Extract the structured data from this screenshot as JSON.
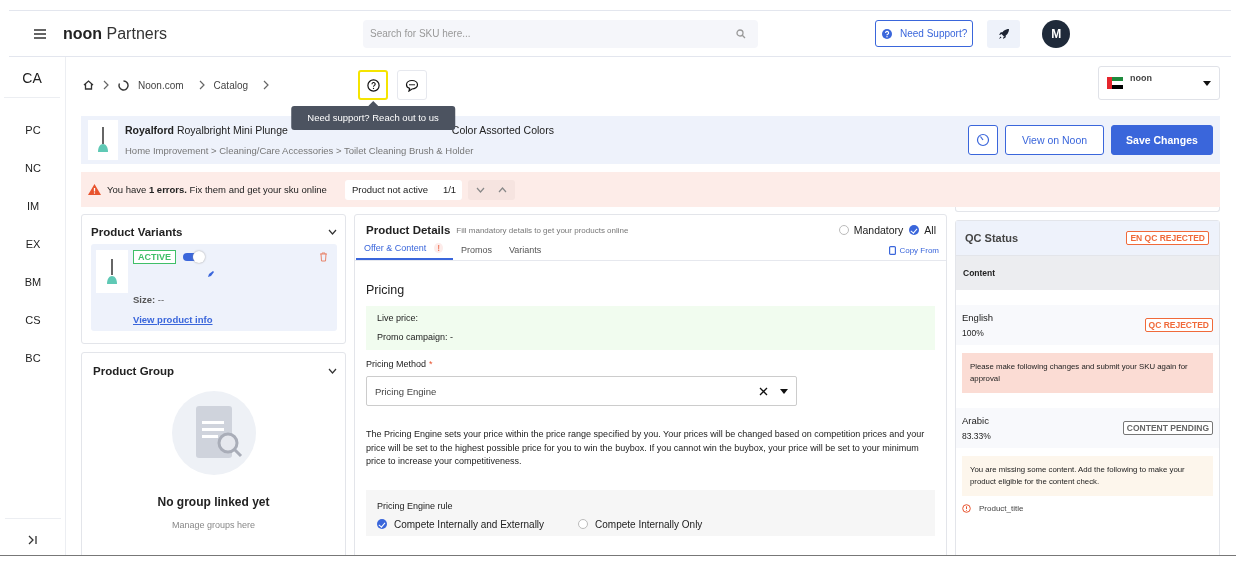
{
  "header": {
    "brand_bold": "noon",
    "brand_rest": "Partners",
    "search": {
      "placeholder": "Search for SKU here..."
    },
    "support_button": "Need Support?",
    "avatar": "M"
  },
  "sidebar": {
    "top": "CA",
    "items": [
      "PC",
      "NC",
      "IM",
      "EX",
      "BM",
      "CS",
      "BC"
    ]
  },
  "breadcrumb": [
    "Noon.com",
    "Catalog"
  ],
  "help_button": {
    "highlighted": true
  },
  "tooltip": "Need support? Reach out to us",
  "store_selector": {
    "name": "noon"
  },
  "product": {
    "brand": "Royalford",
    "title_start": "Royalbright Mini Plunge",
    "title_end": "Color Assorted Colors",
    "category": "Home Improvement > Cleaning/Care Accessories > Toilet Cleaning Brush & Holder"
  },
  "actions": [
    "View on Noon",
    "Save Changes"
  ],
  "error_bar": {
    "message": "You have **1 errors.** Fix them and get your sku online",
    "chip": "Product not active",
    "count": "1/1"
  },
  "variants": {
    "title": "Product Variants",
    "status": "ACTIVE",
    "on": true,
    "size_label": "Size:",
    "size_value": "--",
    "link": "View product info"
  },
  "group": {
    "title": "Product Group",
    "empty_title": "No group linked yet",
    "empty_text": "Manage groups here"
  },
  "details": {
    "title": "Product Details",
    "hint": "Fill mandatory details to get your products online",
    "filters": [
      {
        "label": "Mandatory",
        "selected": false
      },
      {
        "label": "All",
        "selected": true
      }
    ],
    "tabs": [
      {
        "label": "Offer & Content",
        "selected": true,
        "alert": "!"
      },
      {
        "label": "Promos",
        "selected": false
      },
      {
        "label": "Variants",
        "selected": false
      }
    ],
    "copy_from": "Copy From",
    "section": "Pricing",
    "live_price": "Live price:",
    "promo": "Promo campaign: -",
    "method_label": "Pricing Method",
    "required_mark": "*",
    "method_value": "Pricing Engine",
    "description": "The Pricing Engine sets your price within the price range specified by you. Your prices will be changed based on competition prices and your price will be set to the highest possible price for you to win the buybox. If you cannot win the buybox, your price will be set to your minimum price to increase your competitiveness.",
    "rule_title": "Pricing Engine rule",
    "rules": [
      {
        "label": "Compete Internally and Externally",
        "selected": true
      },
      {
        "label": "Compete Internally Only",
        "selected": false
      }
    ]
  },
  "qc": {
    "title": "QC Status",
    "badge": "EN QC REJECTED",
    "section": "Content",
    "languages": [
      {
        "name": "English",
        "percent": "100%",
        "status": "QC REJECTED",
        "kind": "rejected",
        "message": "Please make following changes and submit your SKU again for approval"
      },
      {
        "name": "Arabic",
        "percent": "83.33%",
        "status": "CONTENT PENDING",
        "kind": "pending",
        "message": "You are missing some content. Add the following to make your product eligible for the content check."
      }
    ],
    "missing": [
      "Product_title"
    ]
  }
}
